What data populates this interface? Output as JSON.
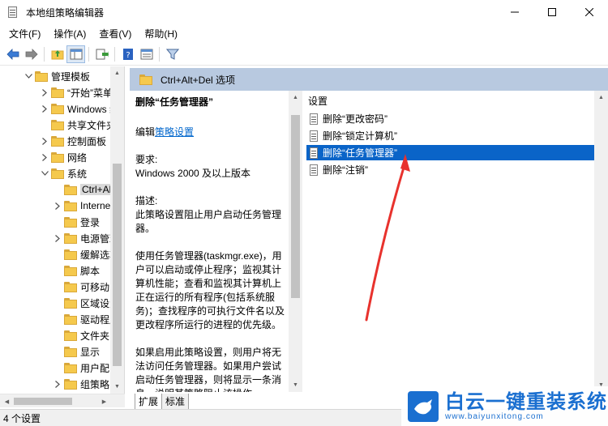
{
  "window": {
    "title": "本地组策略编辑器",
    "minimize_glyph": "─",
    "maximize_glyph": "☐",
    "close_glyph": "✕"
  },
  "menu": [
    "文件(F)",
    "操作(A)",
    "查看(V)",
    "帮助(H)"
  ],
  "toolbar": {
    "icons": [
      "back-icon",
      "forward-icon",
      "up-folder-icon",
      "show-hide-tree-icon",
      "export-list-icon",
      "help-icon",
      "properties-icon",
      "filter-icon"
    ]
  },
  "tree": {
    "items": [
      {
        "label": "管理模板",
        "expanded": true,
        "has_arrow": true
      },
      {
        "label": "“开始”菜单",
        "has_arrow": true
      },
      {
        "label": "Windows 组",
        "has_arrow": true
      },
      {
        "label": "共享文件夹",
        "has_arrow": false
      },
      {
        "label": "控制面板",
        "has_arrow": true
      },
      {
        "label": "网络",
        "has_arrow": true
      },
      {
        "label": "系统",
        "expanded": true,
        "has_arrow": true
      },
      {
        "label": "Ctrl+Al",
        "selected": true,
        "has_arrow": false
      },
      {
        "label": "Internet",
        "has_arrow": true
      },
      {
        "label": "登录",
        "has_arrow": false
      },
      {
        "label": "电源管理",
        "has_arrow": true
      },
      {
        "label": "缓解选项",
        "has_arrow": false
      },
      {
        "label": "脚本",
        "has_arrow": false
      },
      {
        "label": "可移动",
        "has_arrow": false
      },
      {
        "label": "区域设置",
        "has_arrow": false
      },
      {
        "label": "驱动程序",
        "has_arrow": false
      },
      {
        "label": "文件夹",
        "has_arrow": false
      },
      {
        "label": "显示",
        "has_arrow": false
      },
      {
        "label": "用户配",
        "has_arrow": false
      },
      {
        "label": "组策略",
        "has_arrow": true
      }
    ]
  },
  "header": {
    "title": "Ctrl+Alt+Del 选项"
  },
  "description": {
    "title": "删除“任务管理器”",
    "edit_prefix": "编辑",
    "edit_link": "策略设置",
    "req_label": "要求:",
    "req_value": "Windows 2000 及以上版本",
    "desc_label": "描述:",
    "desc_text": "此策略设置阻止用户启动任务管理器。",
    "usage_text": "使用任务管理器(taskmgr.exe)，用户可以启动或停止程序；监视其计算机性能；查看和监视其计算机上正在运行的所有程序(包括系统服务)；查找程序的可执行文件名以及更改程序所运行的进程的优先级。",
    "enable_text": "如果启用此策略设置，则用户将无法访问任务管理器。如果用户尝试启动任务管理器，则将显示一条消息，说明其策略阻止该操作。"
  },
  "settings": {
    "header": "设置",
    "items": [
      {
        "label": "删除“更改密码”",
        "selected": false
      },
      {
        "label": "删除“锁定计算机”",
        "selected": false
      },
      {
        "label": "删除“任务管理器”",
        "selected": true
      },
      {
        "label": "删除“注销”",
        "selected": false
      }
    ]
  },
  "tabs": [
    "扩展",
    "标准"
  ],
  "status": "4 个设置",
  "watermark": {
    "title": "白云一键重装系统",
    "url": "www.baiyunxitong.com"
  },
  "colors": {
    "selection": "#0a64c8",
    "header_bg": "#b8c9e0",
    "annotation": "#e8322d",
    "brand": "#1a6fd0"
  }
}
